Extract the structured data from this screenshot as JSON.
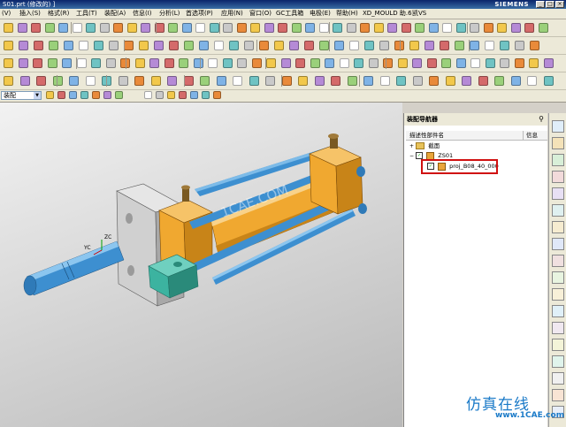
{
  "window": {
    "title": "S01.prt (修改的) ]",
    "brand": "SIEMENS"
  },
  "menubar": [
    "(V)",
    "插入(S)",
    "格式(R)",
    "工具(T)",
    "装配(A)",
    "信息(I)",
    "分析(L)",
    "首选项(P)",
    "应用(N)",
    "窗口(O)",
    "GC工具箱",
    "电极(E)",
    "帮助(H)",
    "XD_MOULD 助.6",
    "凯VS"
  ],
  "filter": {
    "value": "装配"
  },
  "navigator": {
    "title": "装配导航器",
    "col_desc": "描述性部件名",
    "col_info": "信息",
    "rows": [
      {
        "label": "截面"
      },
      {
        "label": "ZS01"
      },
      {
        "label": "proj_B08_40_000"
      }
    ]
  },
  "viewport": {
    "axis_labels": [
      "YC",
      "ZC"
    ],
    "ghost": "1CAE.COM"
  },
  "watermark": {
    "text": "仿真在线",
    "site": "www.1CAE.com"
  },
  "colors": {
    "cylinder_orange": "#f0a830",
    "rod_blue": "#3d8fd0",
    "mount_gray": "#c8c8c8",
    "bracket_teal": "#3cb3a0",
    "highlight_red": "#d01010"
  }
}
